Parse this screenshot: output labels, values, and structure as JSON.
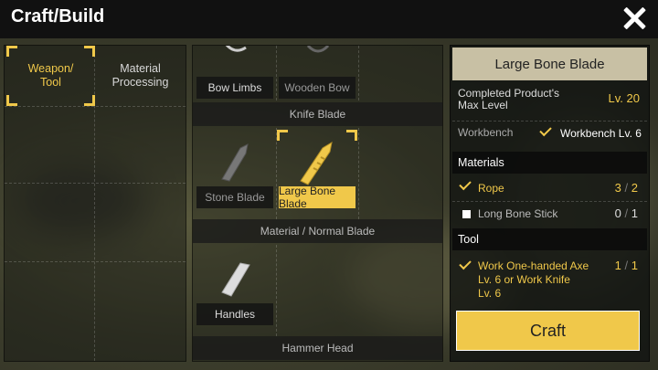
{
  "window": {
    "title": "Craft/Build"
  },
  "categories": [
    {
      "label_line1": "Weapon/",
      "label_line2": "Tool",
      "active": true
    },
    {
      "label_line1": "Material",
      "label_line2": "Processing",
      "active": false
    }
  ],
  "recipes": {
    "row1": [
      {
        "label": "Bow Limbs",
        "style": "normal"
      },
      {
        "label": "Wooden Bow",
        "style": "dim"
      }
    ],
    "section_knife": "Knife Blade",
    "row2": [
      {
        "label": "Stone Blade",
        "style": "dim"
      },
      {
        "label": "Large Bone Blade",
        "style": "selected"
      }
    ],
    "section_material": "Material / Normal Blade",
    "row3": [
      {
        "label": "Handles",
        "style": "normal"
      }
    ],
    "section_hammer": "Hammer Head"
  },
  "detail": {
    "name": "Large Bone Blade",
    "max_level_label_line1": "Completed Product's",
    "max_level_label_line2": "Max Level",
    "max_level_value": "Lv. 20",
    "workbench_label": "Workbench",
    "workbench_value": "Workbench Lv. 6",
    "materials_header": "Materials",
    "materials": [
      {
        "name": "Rope",
        "have": "3",
        "sep": "/",
        "need": "2",
        "met": true
      },
      {
        "name": "Long Bone Stick",
        "have": "0",
        "sep": "/",
        "need": "1",
        "met": false
      }
    ],
    "tool_header": "Tool",
    "tool": {
      "line1": "Work One-handed Axe",
      "line2": "Lv. 6 or Work Knife",
      "line3": "Lv. 6",
      "have": "1",
      "sep": "/",
      "need": "1",
      "met": true
    },
    "craft_label": "Craft"
  },
  "colors": {
    "accent": "#f0c84a",
    "title_bg": "#c8c0a4"
  }
}
